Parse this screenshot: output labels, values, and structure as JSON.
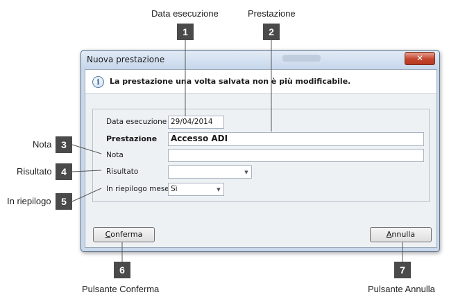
{
  "window": {
    "title": "Nuova prestazione",
    "close_glyph": "✕",
    "info_icon_glyph": "i",
    "info_message": "La prestazione una volta salvata non è più modificabile."
  },
  "form": {
    "data_esecuzione": {
      "label": "Data esecuzione",
      "value": "29/04/2014"
    },
    "prestazione": {
      "label": "Prestazione",
      "value": "Accesso ADI"
    },
    "nota": {
      "label": "Nota",
      "value": ""
    },
    "risultato": {
      "label": "Risultato",
      "value": ""
    },
    "riepilogo": {
      "label": "In riepilogo mese",
      "value": "Sì"
    }
  },
  "buttons": {
    "conferma": {
      "mnemonic": "C",
      "rest": "onferma"
    },
    "annulla": {
      "mnemonic": "A",
      "rest": "nnulla"
    }
  },
  "callouts": {
    "c1": {
      "number": "1",
      "label": "Data esecuzione"
    },
    "c2": {
      "number": "2",
      "label": "Prestazione"
    },
    "c3": {
      "number": "3",
      "label": "Nota"
    },
    "c4": {
      "number": "4",
      "label": "Risultato"
    },
    "c5": {
      "number": "5",
      "label": "In riepilogo"
    },
    "c6": {
      "number": "6",
      "label": "Pulsante Conferma"
    },
    "c7": {
      "number": "7",
      "label": "Pulsante Annulla"
    }
  },
  "colors": {
    "badge": "#4a4a4a",
    "window_frame": "#c9d8ea",
    "close_button": "#c4452c"
  }
}
